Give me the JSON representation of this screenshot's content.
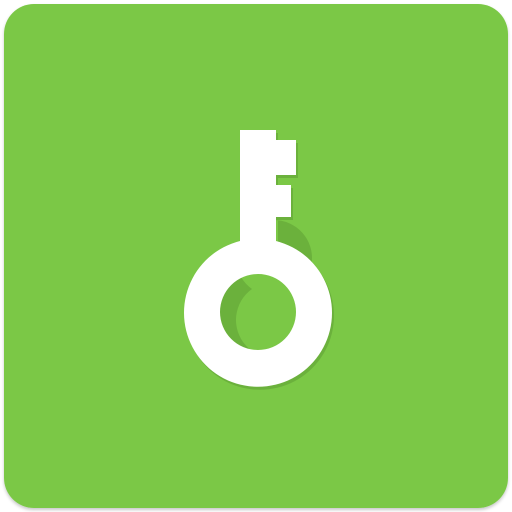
{
  "app_icon": {
    "icon": "key-icon",
    "colors": {
      "background": "#7BC846",
      "glyph": "#FFFFFF",
      "glyph_shadow": "#5E9F34"
    }
  }
}
